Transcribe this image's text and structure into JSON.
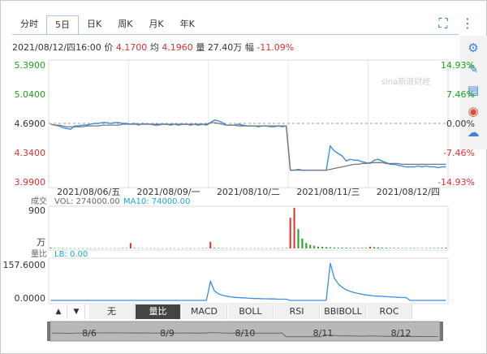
{
  "tabs": [
    {
      "label": "分时",
      "active": false
    },
    {
      "label": "5日",
      "active": true
    },
    {
      "label": "日K",
      "active": false
    },
    {
      "label": "周K",
      "active": false
    },
    {
      "label": "月K",
      "active": false
    },
    {
      "label": "年K",
      "active": false
    }
  ],
  "toolbar_icons": [
    "fullscreen-icon",
    "more-vertical-icon"
  ],
  "side_icons": [
    "settings-gear-icon",
    "pencil-icon",
    "notes-icon",
    "weibo-icon",
    "wechat-icon"
  ],
  "info": {
    "datetime": "2021/08/12/四16:00",
    "price_label": "价",
    "price": "4.1700",
    "avg_label": "均",
    "avg": "4.1960",
    "vol_label": "量",
    "vol": "27.40万",
    "chg_label": "幅",
    "chg": "-11.09%"
  },
  "watermark": "sina新浪财经",
  "indicator_tabs": [
    {
      "label": "无",
      "active": false
    },
    {
      "label": "量比",
      "active": true
    },
    {
      "label": "MACD",
      "active": false
    },
    {
      "label": "BOLL",
      "active": false
    },
    {
      "label": "RSI",
      "active": false
    },
    {
      "label": "BBIBOLL",
      "active": false
    },
    {
      "label": "ROC",
      "active": false
    }
  ],
  "arrows": {
    "up": "▲",
    "down": "▼"
  },
  "colors": {
    "up": "#e03030",
    "down": "#1ea11e",
    "price_line": "#3a8ee6",
    "avg_line": "#888888",
    "accent": "#2b6fd6"
  },
  "chart_data": [
    {
      "type": "line",
      "name": "price",
      "ylim": [
        3.99,
        5.39
      ],
      "y_ticks_left": [
        "5.3900",
        "5.0400",
        "4.6900",
        "4.3400",
        "3.9900"
      ],
      "y_ticks_right": [
        "14.93%",
        "7.46%",
        "0.00%",
        "-7.46%",
        "-14.93%"
      ],
      "prev_close": 4.69,
      "x_labels": [
        "2021/08/06/五",
        "2021/08/09/一",
        "2021/08/10/二",
        "2021/08/11/三",
        "2021/08/12/四"
      ],
      "series": [
        {
          "values": [
            4.68,
            4.67,
            4.66,
            4.64,
            4.63,
            4.62,
            4.66,
            4.66,
            4.67,
            4.67,
            4.68,
            4.69,
            4.69,
            4.7,
            4.7,
            4.69,
            4.7,
            4.7,
            4.69,
            4.69,
            4.68,
            4.69,
            4.67,
            4.69,
            4.68,
            4.68,
            4.67,
            4.67,
            4.68,
            4.68,
            4.67,
            4.68,
            4.67,
            4.68,
            4.68,
            4.67,
            4.68,
            4.67,
            4.68,
            4.67,
            4.7,
            4.73,
            4.72,
            4.7,
            4.67,
            4.67,
            4.67,
            4.68,
            4.67,
            4.66,
            4.66,
            4.66,
            4.65,
            4.66,
            4.66,
            4.65,
            4.65,
            4.66,
            4.65,
            4.66,
            4.13,
            4.13,
            4.14,
            4.13,
            4.13,
            4.13,
            4.13,
            4.13,
            4.13,
            4.13,
            4.42,
            4.36,
            4.33,
            4.3,
            4.24,
            4.26,
            4.25,
            4.25,
            4.23,
            4.22,
            4.21,
            4.25,
            4.26,
            4.24,
            4.22,
            4.2,
            4.2,
            4.19,
            4.18,
            4.17,
            4.17,
            4.17,
            4.18,
            4.17,
            4.18,
            4.17,
            4.17,
            4.16,
            4.17,
            4.17
          ]
        },
        {
          "values": [
            4.68,
            4.67,
            4.67,
            4.66,
            4.65,
            4.65,
            4.65,
            4.65,
            4.65,
            4.66,
            4.66,
            4.66,
            4.66,
            4.67,
            4.67,
            4.67,
            4.67,
            4.67,
            4.68,
            4.68,
            4.68,
            4.68,
            4.68,
            4.68,
            4.68,
            4.68,
            4.68,
            4.68,
            4.68,
            4.68,
            4.68,
            4.68,
            4.68,
            4.68,
            4.68,
            4.68,
            4.68,
            4.68,
            4.68,
            4.68,
            4.7,
            4.7,
            4.69,
            4.68,
            4.67,
            4.67,
            4.67,
            4.66,
            4.66,
            4.66,
            4.66,
            4.66,
            4.66,
            4.66,
            4.66,
            4.66,
            4.66,
            4.66,
            4.66,
            4.66,
            4.13,
            4.13,
            4.13,
            4.13,
            4.13,
            4.13,
            4.13,
            4.13,
            4.13,
            4.13,
            4.14,
            4.15,
            4.16,
            4.17,
            4.18,
            4.19,
            4.2,
            4.2,
            4.21,
            4.21,
            4.22,
            4.22,
            4.22,
            4.22,
            4.21,
            4.21,
            4.21,
            4.21,
            4.2,
            4.2,
            4.2,
            4.2,
            4.2,
            4.2,
            4.2,
            4.2,
            4.2,
            4.2,
            4.2,
            4.2
          ]
        }
      ]
    },
    {
      "type": "bar",
      "name": "volume",
      "label": "成交",
      "legend_vol": "VOL: 274000.00",
      "legend_ma": "MA10: 74000.00",
      "y_ticks": [
        "900",
        "万"
      ],
      "ylim": [
        0,
        900
      ],
      "values": [
        22,
        9,
        8,
        7,
        6,
        5,
        5,
        5,
        5,
        5,
        4,
        4,
        4,
        5,
        5,
        5,
        6,
        6,
        8,
        10,
        120,
        12,
        8,
        6,
        5,
        5,
        4,
        4,
        4,
        5,
        5,
        4,
        4,
        4,
        5,
        5,
        5,
        6,
        7,
        10,
        150,
        15,
        9,
        7,
        6,
        5,
        5,
        5,
        5,
        5,
        4,
        4,
        5,
        5,
        5,
        5,
        6,
        6,
        8,
        12,
        680,
        900,
        430,
        220,
        120,
        80,
        60,
        40,
        35,
        30,
        25,
        22,
        20,
        18,
        16,
        15,
        14,
        13,
        12,
        14,
        40,
        30,
        22,
        18,
        15,
        14,
        12,
        12,
        11,
        10,
        10,
        10,
        9,
        9,
        10,
        10,
        11,
        12,
        14,
        18
      ],
      "colors_up_index": [
        20,
        40,
        60,
        61,
        80
      ]
    },
    {
      "type": "line",
      "name": "volume-ratio",
      "label": "量比",
      "legend_lb": "LB: 0.00",
      "y_ticks": [
        "157.6000",
        "0.0000"
      ],
      "ylim": [
        0,
        157.6
      ],
      "values": [
        0,
        0,
        0,
        0,
        0,
        0,
        0,
        0,
        0,
        0,
        0,
        0,
        0,
        0,
        0,
        0,
        0,
        0,
        0,
        0,
        0,
        0,
        0,
        0,
        0,
        0,
        0,
        0,
        0,
        0,
        0,
        0,
        0,
        0,
        0,
        0,
        0,
        0,
        0,
        0,
        80,
        40,
        28,
        22,
        18,
        15,
        13,
        12,
        11,
        10,
        9,
        8,
        8,
        7,
        7,
        6,
        6,
        5,
        5,
        5,
        0,
        0,
        0,
        0,
        0,
        0,
        0,
        0,
        0,
        0,
        157.6,
        95,
        70,
        55,
        45,
        38,
        33,
        29,
        26,
        23,
        21,
        19,
        18,
        17,
        16,
        15,
        14,
        13,
        12,
        12,
        0,
        0,
        0,
        0,
        0,
        0,
        0,
        0,
        0,
        0
      ]
    }
  ],
  "navigator_labels": [
    "8/6",
    "8/9",
    "8/10",
    "8/11",
    "8/12"
  ]
}
